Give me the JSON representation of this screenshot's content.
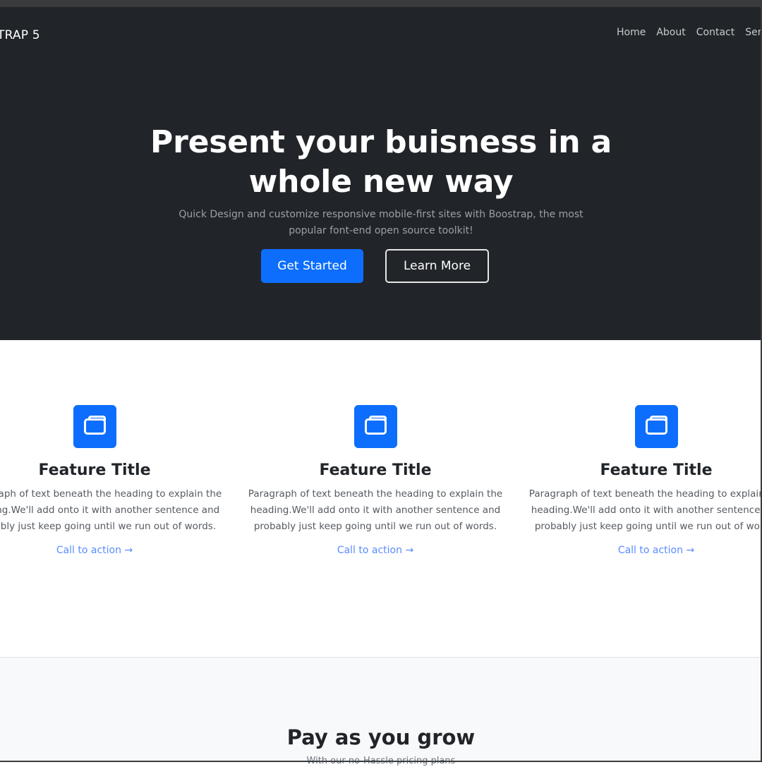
{
  "navbar": {
    "brand": "TRAP 5",
    "links": [
      "Home",
      "About",
      "Contact",
      "Ser"
    ]
  },
  "hero": {
    "title": "Present your buisness in a whole new way",
    "subtitle": "Quick Design and customize responsive mobile-first sites with Boostrap, the most popular font-end open source toolkit!",
    "primary_button": "Get Started",
    "secondary_button": "Learn More"
  },
  "features": [
    {
      "icon": "collection-icon",
      "title": "Feature Title",
      "text": "Paragraph of text beneath the heading to explain the heading.We'll add onto it with another sentence and probably just keep going until we run out of words.",
      "cta": "Call to action →"
    },
    {
      "icon": "collection-icon",
      "title": "Feature Title",
      "text": "Paragraph of text beneath the heading to explain the heading.We'll add onto it with another sentence and probably just keep going until we run out of words.",
      "cta": "Call to action →"
    },
    {
      "icon": "collection-icon",
      "title": "Feature Title",
      "text": "Paragraph of text beneath the heading to explain the heading.We'll add onto it with another sentence and probably just keep going until we run out of words.",
      "cta": "Call to action →"
    }
  ],
  "pricing": {
    "title": "Pay as you grow",
    "subtitle": "With our no-Hassle pricing plans"
  },
  "colors": {
    "hero_bg": "#212529",
    "primary": "#0d6efd",
    "link": "#5b8cff"
  }
}
